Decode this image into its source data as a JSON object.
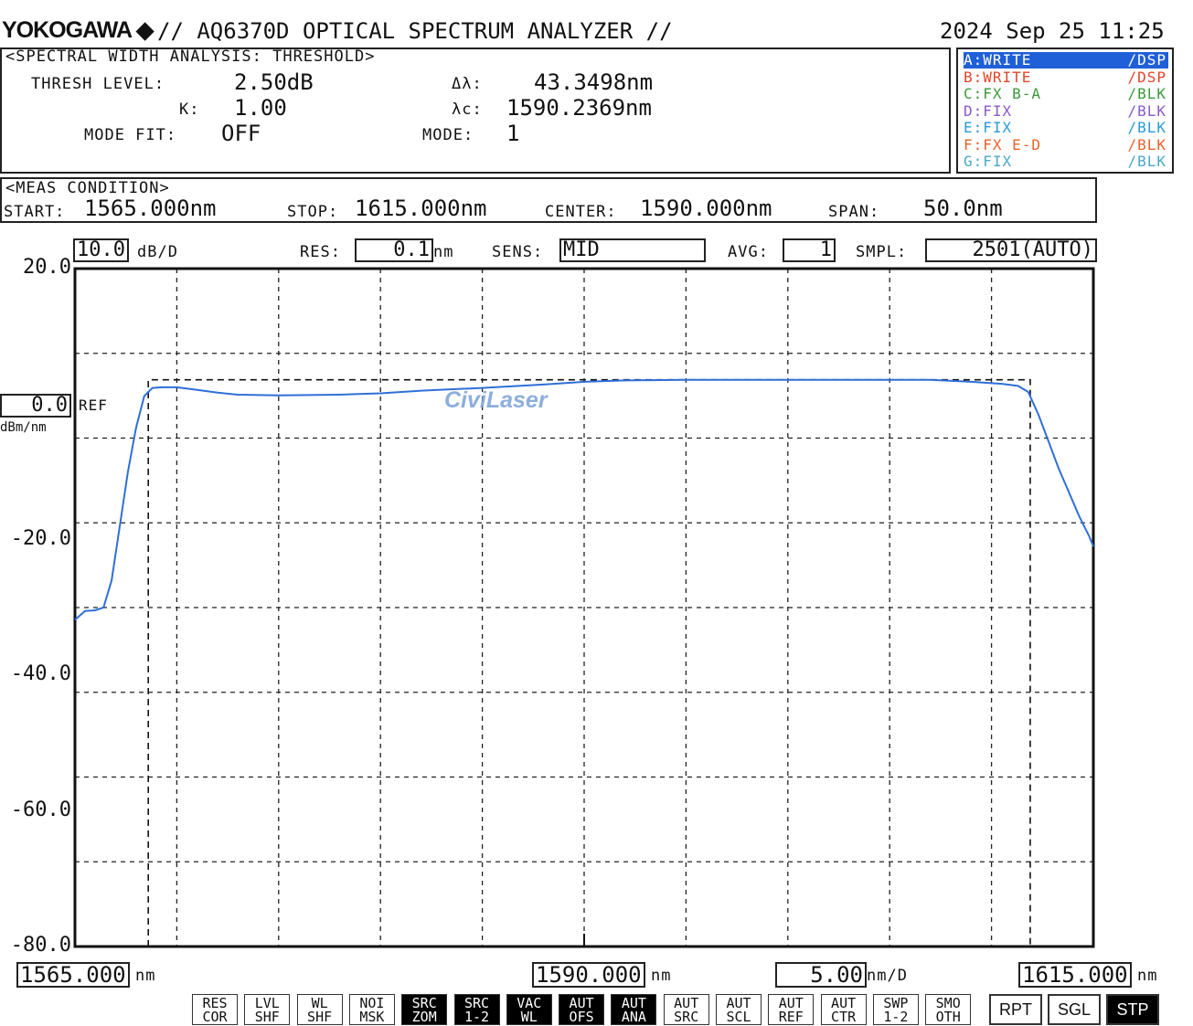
{
  "header": {
    "brand": "YOKOGAWA",
    "brand_mark": "◆",
    "title": "// AQ6370D OPTICAL SPECTRUM ANALYZER //",
    "datetime": "2024 Sep 25 11:25"
  },
  "analysis": {
    "heading": "<SPECTRAL WIDTH ANALYSIS: THRESHOLD>",
    "thresh_label": "THRESH LEVEL:",
    "thresh_value": "2.50dB",
    "k_label": "K:",
    "k_value": "1.00",
    "mode_fit_label": "MODE FIT:",
    "mode_fit_value": "OFF",
    "dl_label": "Δλ:",
    "dl_value": "43.3498nm",
    "lc_label": "λc:",
    "lc_value": "1590.2369nm",
    "mode_label": "MODE:",
    "mode_value": "1"
  },
  "traces": [
    {
      "label": "A:WRITE",
      "mode": "/DSP",
      "color": "#ffffff",
      "bg": "#1f5fd8"
    },
    {
      "label": "B:WRITE",
      "mode": "/DSP",
      "color": "#e0452a",
      "bg": ""
    },
    {
      "label": "C:FX B-A",
      "mode": "/BLK",
      "color": "#3a9a3a",
      "bg": ""
    },
    {
      "label": "D:FIX",
      "mode": "/BLK",
      "color": "#8a5ac8",
      "bg": ""
    },
    {
      "label": "E:FIX",
      "mode": "/BLK",
      "color": "#2a9ad8",
      "bg": ""
    },
    {
      "label": "F:FX E-D",
      "mode": "/BLK",
      "color": "#e8622a",
      "bg": ""
    },
    {
      "label": "G:FIX",
      "mode": "/BLK",
      "color": "#4aa8c8",
      "bg": ""
    }
  ],
  "meas": {
    "heading": "<MEAS CONDITION>",
    "start_label": "START:",
    "start_value": "1565.000nm",
    "stop_label": "STOP:",
    "stop_value": "1615.000nm",
    "center_label": "CENTER:",
    "center_value": "1590.000nm",
    "span_label": "SPAN:",
    "span_value": "50.0nm"
  },
  "settings": {
    "scale_value": "10.0",
    "scale_unit": "dB/D",
    "res_label": "RES:",
    "res_value": "0.1",
    "res_unit": "nm",
    "sens_label": "SENS:",
    "sens_value": "MID",
    "avg_label": "AVG:",
    "avg_value": "1",
    "smpl_label": "SMPL:",
    "smpl_value": "2501(AUTO)"
  },
  "ref": {
    "value": "0.0",
    "label": "REF",
    "unit": "dBm/nm"
  },
  "bottom_axis": {
    "start_value": "1565.000",
    "start_unit": "nm",
    "center_value": "1590.000",
    "center_unit": "nm",
    "span_div_value": "5.00",
    "span_div_unit": "nm/D",
    "stop_value": "1615.000",
    "stop_unit": "nm"
  },
  "watermark": "CiviLaser",
  "softkeys": [
    {
      "l1": "RES",
      "l2": "COR",
      "on": false
    },
    {
      "l1": "LVL",
      "l2": "SHF",
      "on": false
    },
    {
      "l1": "WL",
      "l2": "SHF",
      "on": false
    },
    {
      "l1": "NOI",
      "l2": "MSK",
      "on": false
    },
    {
      "l1": "SRC",
      "l2": "ZOM",
      "on": true
    },
    {
      "l1": "SRC",
      "l2": "1-2",
      "on": true
    },
    {
      "l1": "VAC",
      "l2": "WL",
      "on": true
    },
    {
      "l1": "AUT",
      "l2": "OFS",
      "on": true
    },
    {
      "l1": "AUT",
      "l2": "ANA",
      "on": true
    },
    {
      "l1": "AUT",
      "l2": "SRC",
      "on": false
    },
    {
      "l1": "AUT",
      "l2": "SCL",
      "on": false
    },
    {
      "l1": "AUT",
      "l2": "REF",
      "on": false
    },
    {
      "l1": "AUT",
      "l2": "CTR",
      "on": false
    },
    {
      "l1": "SWP",
      "l2": "1-2",
      "on": false
    },
    {
      "l1": "SMO",
      "l2": "OTH",
      "on": false
    }
  ],
  "function_keys": [
    {
      "label": "RPT",
      "on": false
    },
    {
      "label": "SGL",
      "on": false
    },
    {
      "label": "STP",
      "on": true
    }
  ],
  "chart_data": {
    "type": "line",
    "title": "",
    "xlabel": "",
    "ylabel": "",
    "xlim": [
      1565.0,
      1615.0
    ],
    "ylim": [
      -80.0,
      20.0
    ],
    "y_ticks": [
      "20.0",
      "-20.0",
      "-40.0",
      "-60.0",
      "-80.0"
    ],
    "y_tick_values": [
      20.0,
      -20.0,
      -40.0,
      -60.0,
      -80.0
    ],
    "grid": true,
    "x_divisions": 10,
    "y_divisions": 8,
    "threshold_box": {
      "x_left": 1568.6,
      "x_right": 1611.9,
      "y_top": 3.6,
      "y_bottom": -80.0
    },
    "series": [
      {
        "color": "#2f6fd8",
        "x": [
          1565.0,
          1565.5,
          1566.0,
          1566.4,
          1566.8,
          1567.2,
          1567.6,
          1568.0,
          1568.4,
          1568.8,
          1569.3,
          1570.0,
          1571.0,
          1572.0,
          1573.0,
          1575.0,
          1578.0,
          1580.0,
          1582.0,
          1585.0,
          1588.0,
          1590.0,
          1592.0,
          1595.0,
          1598.0,
          1600.0,
          1603.0,
          1605.0,
          1607.0,
          1609.0,
          1610.5,
          1611.3,
          1611.8,
          1612.3,
          1612.8,
          1613.3,
          1613.8,
          1614.3,
          1614.8,
          1615.0
        ],
        "y": [
          -31.8,
          -30.5,
          -30.4,
          -30.0,
          -26.0,
          -18.0,
          -10.0,
          -3.5,
          1.2,
          2.4,
          2.5,
          2.5,
          2.1,
          1.7,
          1.4,
          1.3,
          1.4,
          1.6,
          2.0,
          2.4,
          2.9,
          3.3,
          3.5,
          3.6,
          3.6,
          3.6,
          3.6,
          3.6,
          3.6,
          3.3,
          3.0,
          2.7,
          1.8,
          -1.5,
          -5.5,
          -9.5,
          -13.0,
          -16.5,
          -19.5,
          -21.0
        ]
      }
    ]
  }
}
